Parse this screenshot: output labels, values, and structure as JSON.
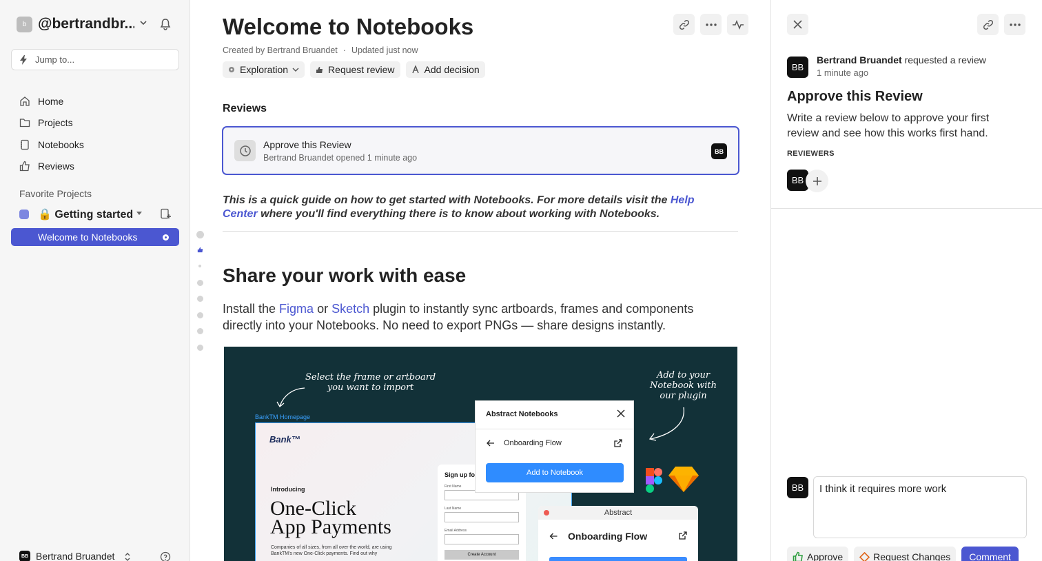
{
  "sidebar": {
    "workspace_initial": "b",
    "workspace_name": "@bertrandbr...",
    "jump_placeholder": "Jump to...",
    "nav": [
      {
        "label": "Home",
        "icon": "home-icon"
      },
      {
        "label": "Projects",
        "icon": "folder-icon"
      },
      {
        "label": "Notebooks",
        "icon": "notebook-icon"
      },
      {
        "label": "Reviews",
        "icon": "thumbs-up-icon"
      }
    ],
    "favorites_heading": "Favorite Projects",
    "project": {
      "lock": "🔒",
      "name": "Getting started",
      "color": "#7d87e0"
    },
    "active_notebook": "Welcome to Notebooks",
    "user_initials": "BB",
    "user_name": "Bertrand Bruandet"
  },
  "main": {
    "title": "Welcome to Notebooks",
    "created_by": "Created by Bertrand Bruandet",
    "separator": "·",
    "updated": "Updated just now",
    "chips": {
      "status": "Exploration",
      "request": "Request review",
      "decision": "Add decision"
    },
    "reviews_heading": "Reviews",
    "review_card": {
      "title": "Approve this Review",
      "subtitle": "Bertrand Bruandet opened 1 minute ago",
      "avatar": "BB"
    },
    "intro_part1": "This is a quick guide on how to get started with Notebooks. For more details visit the ",
    "intro_link": "Help Center",
    "intro_part2": " where you'll find everything there is to know about working with Notebooks.",
    "h2": "Share your work with ease",
    "para_p1": "Install the ",
    "para_link1": "Figma",
    "para_p2": " or ",
    "para_link2": "Sketch",
    "para_p3": " plugin to instantly sync artboards, frames and components directly into your Notebooks. No need to export PNGs — share designs instantly.",
    "hero": {
      "hand_left_1": "Select the frame or artboard",
      "hand_left_2": "you want to import",
      "hand_right_1": "Add to your",
      "hand_right_2": "Notebook with",
      "hand_right_3": "our plugin",
      "bank_label": "BankTM Homepage",
      "bank_logo": "Bank™",
      "introducing": "Introducing",
      "oneclick_1": "One-Click",
      "oneclick_2": "App Payments",
      "smallprint": "Companies of all sizes, from all over the world, are using BankTM's new One-Click payments. Find out why",
      "signup_title": "Sign up fo",
      "first_name": "First Name",
      "last_name": "Last Name",
      "email": "Email Address",
      "create": "Create Account",
      "popup_title": "Abstract Notebooks",
      "popup_flow": "Onboarding Flow",
      "popup_button": "Add to Notebook",
      "plugwin_title": "Abstract",
      "plugwin_flow": "Onboarding Flow"
    }
  },
  "panel": {
    "avatar": "BB",
    "requester": "Bertrand Bruandet",
    "request_text": " requested a review",
    "time": "1 minute ago",
    "title": "Approve this Review",
    "description": "Write a review below to approve your first review and see how this works first hand.",
    "reviewers_label": "REVIEWERS",
    "comment_value": "I think it requires more work",
    "approve": "Approve",
    "request_changes": "Request Changes",
    "comment_button": "Comment"
  }
}
